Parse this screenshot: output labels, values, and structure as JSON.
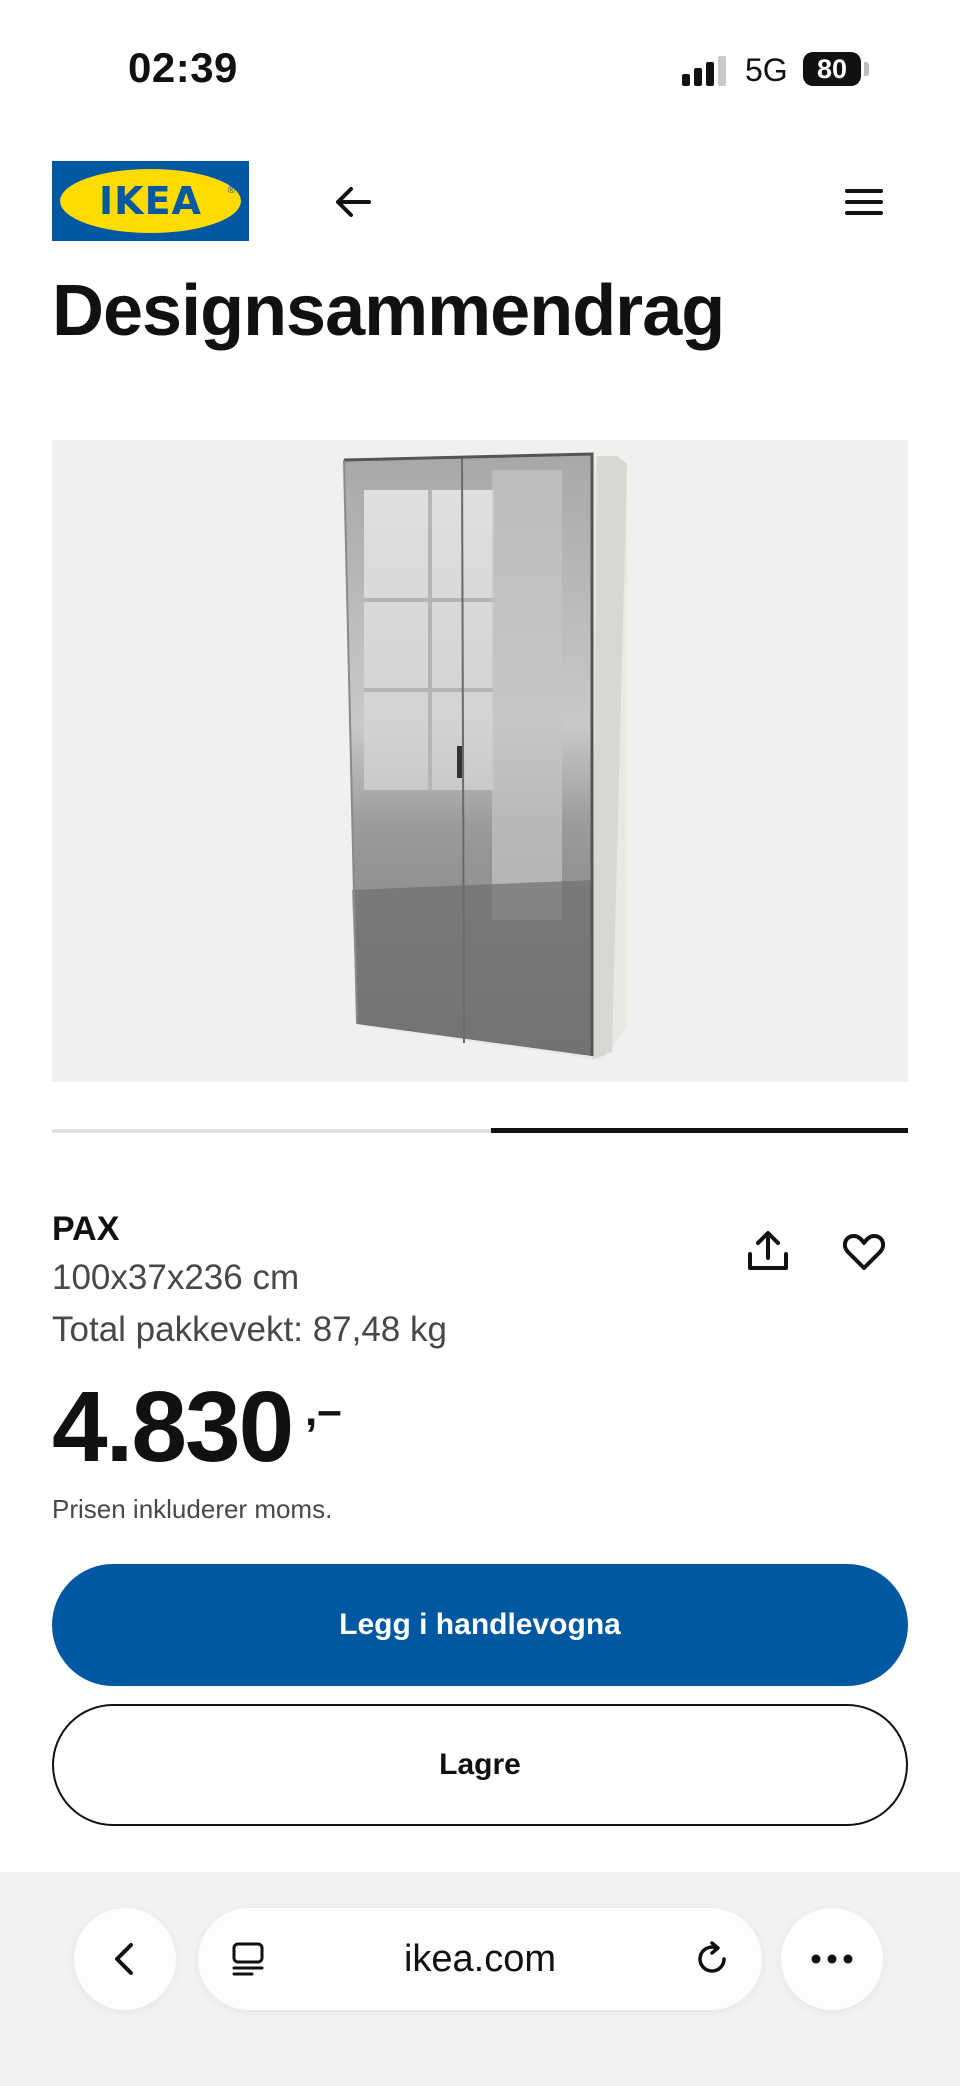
{
  "status_bar": {
    "time": "02:39",
    "network": "5G",
    "battery": "80"
  },
  "header": {
    "logo_text": "IKEA",
    "logo_colors": {
      "background": "#0058a3",
      "ellipse": "#ffdb00"
    },
    "back_icon": "arrow-left-icon",
    "menu_icon": "hamburger-menu-icon"
  },
  "page": {
    "title": "Designsammendrag"
  },
  "carousel": {
    "slide_count": 2,
    "active_slide": 2
  },
  "product": {
    "name": "PAX",
    "dimensions": "100x37x236 cm",
    "weight": "Total pakkevekt: 87,48 kg",
    "price": "4.830",
    "price_suffix": ",–",
    "price_note": "Prisen inkluderer moms.",
    "share_icon": "share-icon",
    "favorite_icon": "heart-icon"
  },
  "actions": {
    "add_to_cart": "Legg i handlevogna",
    "save": "Lagre",
    "primary_color": "#0058a3"
  },
  "browser": {
    "url": "ikea.com",
    "back_icon": "chevron-left-icon",
    "tabs_icon": "tabs-icon",
    "reload_icon": "reload-icon",
    "more_icon": "more-dots-icon"
  }
}
